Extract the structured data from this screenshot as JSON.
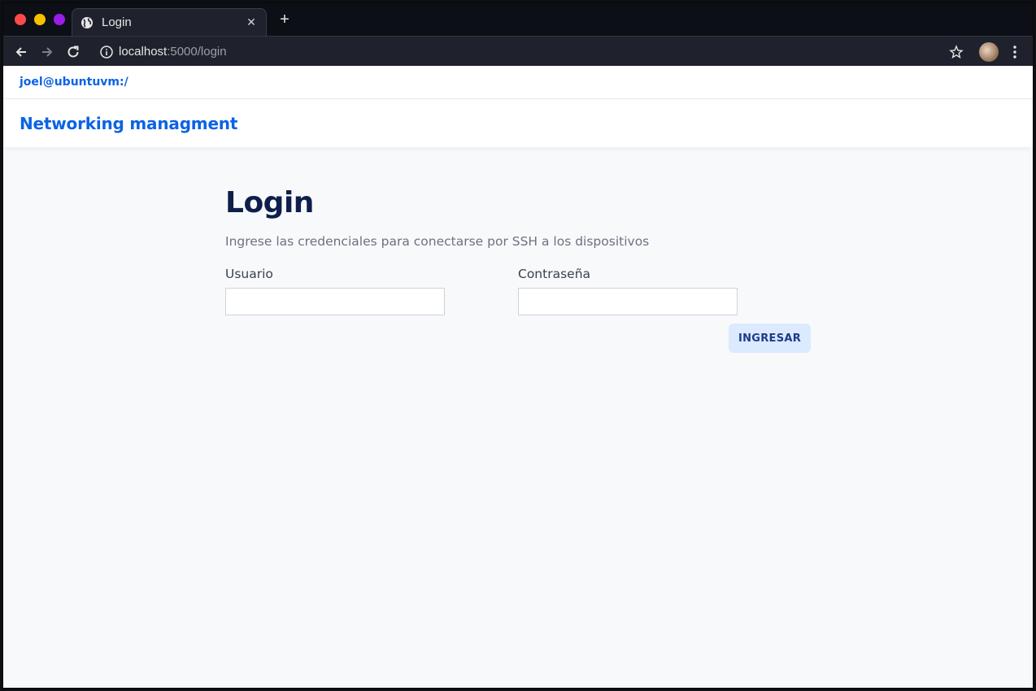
{
  "browser": {
    "tab_title": "Login",
    "url_host": "localhost",
    "url_path": ":5000/login"
  },
  "page": {
    "topbar_user": "joel@ubuntuvm:/",
    "brand": "Networking managment",
    "heading": "Login",
    "subtitle": "Ingrese las credenciales para conectarse por SSH a los dispositivos",
    "form": {
      "user_label": "Usuario",
      "user_value": "",
      "password_label": "Contraseña",
      "password_value": "",
      "submit_label": "INGRESAR"
    }
  },
  "colors": {
    "accent": "#0b63e5",
    "heading": "#0f1f4b",
    "button_bg": "#dbeafe",
    "button_text": "#1e3a8a"
  }
}
